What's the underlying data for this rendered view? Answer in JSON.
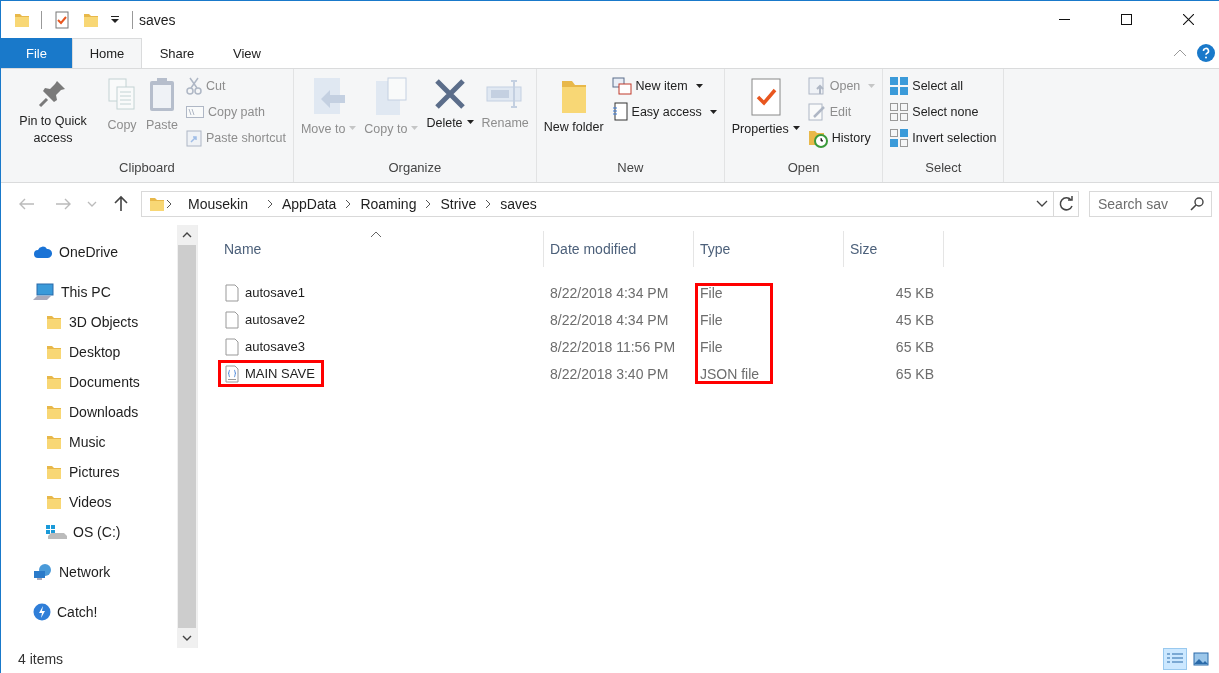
{
  "window": {
    "title": "saves"
  },
  "quick_access": [
    {
      "kind": "folder"
    },
    {
      "kind": "properties"
    },
    {
      "kind": "new-folder"
    },
    {
      "kind": "customize"
    }
  ],
  "tabs": [
    {
      "label": "File",
      "kind": "file",
      "selected": false
    },
    {
      "label": "Home",
      "kind": "tab",
      "selected": true
    },
    {
      "label": "Share",
      "kind": "tab",
      "selected": false
    },
    {
      "label": "View",
      "kind": "tab",
      "selected": false
    }
  ],
  "ribbon": [
    {
      "label": "Clipboard",
      "items": [
        {
          "label": "Pin to Quick access",
          "kind": "large",
          "disabled": false,
          "dropdown": false
        },
        {
          "label": "Copy",
          "kind": "large",
          "disabled": true,
          "dropdown": false
        },
        {
          "label": "Paste",
          "kind": "large",
          "disabled": true,
          "dropdown": false
        },
        {
          "label": "Cut",
          "kind": "small",
          "disabled": true,
          "dropdown": false
        },
        {
          "label": "Copy path",
          "kind": "small",
          "disabled": true,
          "dropdown": false
        },
        {
          "label": "Paste shortcut",
          "kind": "small",
          "disabled": true,
          "dropdown": false
        }
      ]
    },
    {
      "label": "Organize",
      "items": [
        {
          "label": "Move to",
          "kind": "large",
          "disabled": true,
          "dropdown": true
        },
        {
          "label": "Copy to",
          "kind": "large",
          "disabled": true,
          "dropdown": true
        },
        {
          "label": "Delete",
          "kind": "large",
          "disabled": false,
          "dropdown": true
        },
        {
          "label": "Rename",
          "kind": "large",
          "disabled": true,
          "dropdown": false
        }
      ]
    },
    {
      "label": "New",
      "items": [
        {
          "label": "New folder",
          "kind": "large",
          "disabled": false,
          "dropdown": false
        },
        {
          "label": "New item",
          "kind": "small",
          "disabled": false,
          "dropdown": true
        },
        {
          "label": "Easy access",
          "kind": "small",
          "disabled": false,
          "dropdown": true
        }
      ]
    },
    {
      "label": "Open",
      "items": [
        {
          "label": "Properties",
          "kind": "large",
          "disabled": false,
          "dropdown": true
        },
        {
          "label": "Open",
          "kind": "small",
          "disabled": true,
          "dropdown": true
        },
        {
          "label": "Edit",
          "kind": "small",
          "disabled": true,
          "dropdown": false
        },
        {
          "label": "History",
          "kind": "small",
          "disabled": false,
          "dropdown": false
        }
      ]
    },
    {
      "label": "Select",
      "items": [
        {
          "label": "Select all",
          "kind": "small",
          "disabled": false,
          "dropdown": false
        },
        {
          "label": "Select none",
          "kind": "small",
          "disabled": false,
          "dropdown": false
        },
        {
          "label": "Invert selection",
          "kind": "small",
          "disabled": false,
          "dropdown": false
        }
      ]
    }
  ],
  "address_bar": {
    "path": [
      "Mousekin",
      "AppData",
      "Roaming",
      "Strive",
      "saves"
    ]
  },
  "search": {
    "placeholder": "Search sav"
  },
  "navigation": [
    {
      "label": "OneDrive",
      "kind": "cloud"
    },
    {
      "label": "This PC",
      "kind": "pc",
      "children": [
        {
          "label": "3D Objects",
          "kind": "folder"
        },
        {
          "label": "Desktop",
          "kind": "folder"
        },
        {
          "label": "Documents",
          "kind": "folder"
        },
        {
          "label": "Downloads",
          "kind": "folder"
        },
        {
          "label": "Music",
          "kind": "folder"
        },
        {
          "label": "Pictures",
          "kind": "folder"
        },
        {
          "label": "Videos",
          "kind": "folder"
        },
        {
          "label": "OS (C:)",
          "kind": "drive"
        }
      ]
    },
    {
      "label": "Network",
      "kind": "network"
    },
    {
      "label": "Catch!",
      "kind": "app"
    }
  ],
  "table": {
    "columns": [
      {
        "label": "Name",
        "sorted": true,
        "highlighted": false
      },
      {
        "label": "Date modified",
        "sorted": false,
        "highlighted": false
      },
      {
        "label": "Type",
        "sorted": false,
        "highlighted": true
      },
      {
        "label": "Size",
        "sorted": false,
        "highlighted": false
      }
    ],
    "rows": [
      {
        "name": "autosave1",
        "kind": "file",
        "date": "8/22/2018 4:34 PM",
        "type": "File",
        "size": "45 KB",
        "highlighted": false
      },
      {
        "name": "autosave2",
        "kind": "file",
        "date": "8/22/2018 4:34 PM",
        "type": "File",
        "size": "45 KB",
        "highlighted": false
      },
      {
        "name": "autosave3",
        "kind": "file",
        "date": "8/22/2018 11:56 PM",
        "type": "File",
        "size": "65 KB",
        "highlighted": false
      },
      {
        "name": "MAIN SAVE",
        "kind": "json",
        "date": "8/22/2018 3:40 PM",
        "type": "JSON file",
        "size": "65 KB",
        "highlighted": true
      }
    ]
  },
  "status_bar": {
    "text": "4 items",
    "views": [
      {
        "kind": "details",
        "selected": true
      },
      {
        "kind": "tiles",
        "selected": false
      }
    ]
  }
}
